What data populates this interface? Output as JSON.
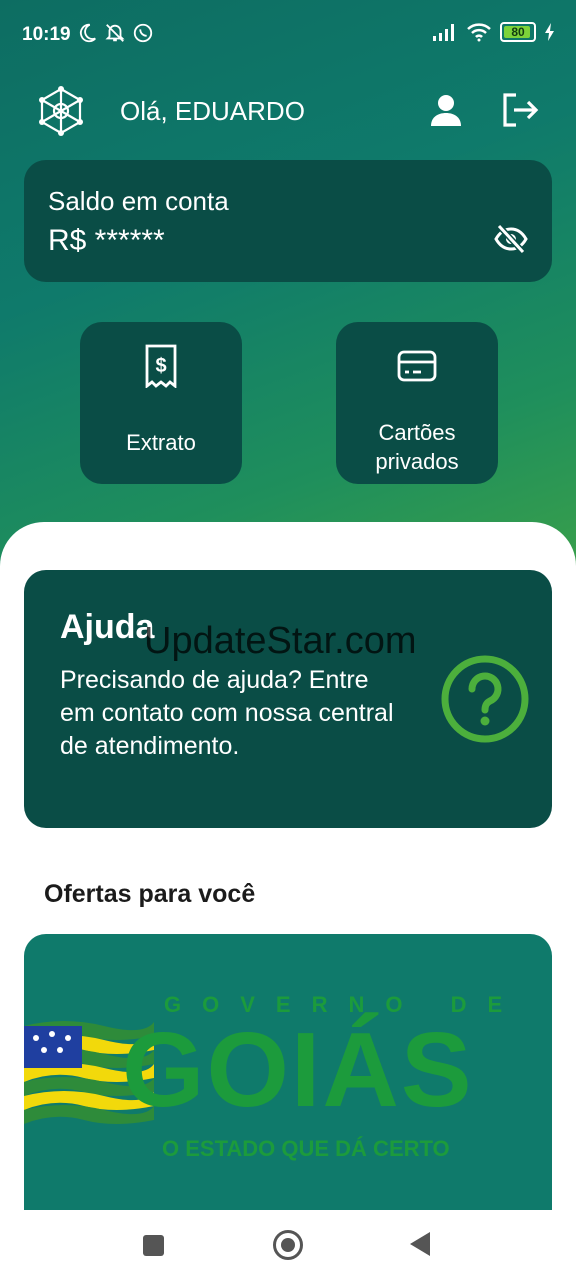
{
  "status_bar": {
    "time": "10:19",
    "battery_level": "80",
    "left_icons": [
      "moon-icon",
      "bell-off-icon",
      "whatsapp-icon"
    ],
    "right_icons": [
      "signal-icon",
      "wifi-icon",
      "battery-icon",
      "charging-icon"
    ]
  },
  "header": {
    "greeting": "Olá, EDUARDO",
    "icons": [
      "network-logo-icon",
      "user-icon",
      "logout-icon"
    ]
  },
  "balance": {
    "title": "Saldo em conta",
    "value": "R$ ******",
    "toggle_icon": "eye-off-icon"
  },
  "actions": [
    {
      "label": "Extrato",
      "icon": "receipt-icon"
    },
    {
      "label": "Cartões privados",
      "icon": "credit-card-icon"
    }
  ],
  "help": {
    "title": "Ajuda",
    "text": "Precisando de ajuda? Entre em contato com nossa central de atendimento.",
    "icon": "question-circle-icon"
  },
  "watermark": "UpdateStar.com",
  "offers": {
    "title": "Ofertas para você",
    "banner": {
      "top": "GOVERNO DE",
      "main": "GOIÁS",
      "sub": "O ESTADO QUE DÁ CERTO"
    }
  },
  "colors": {
    "primary_dark": "#0a4d46",
    "gradient_start": "#0d6d62",
    "gradient_end": "#3aa04a",
    "accent_green": "#4caf3c"
  }
}
